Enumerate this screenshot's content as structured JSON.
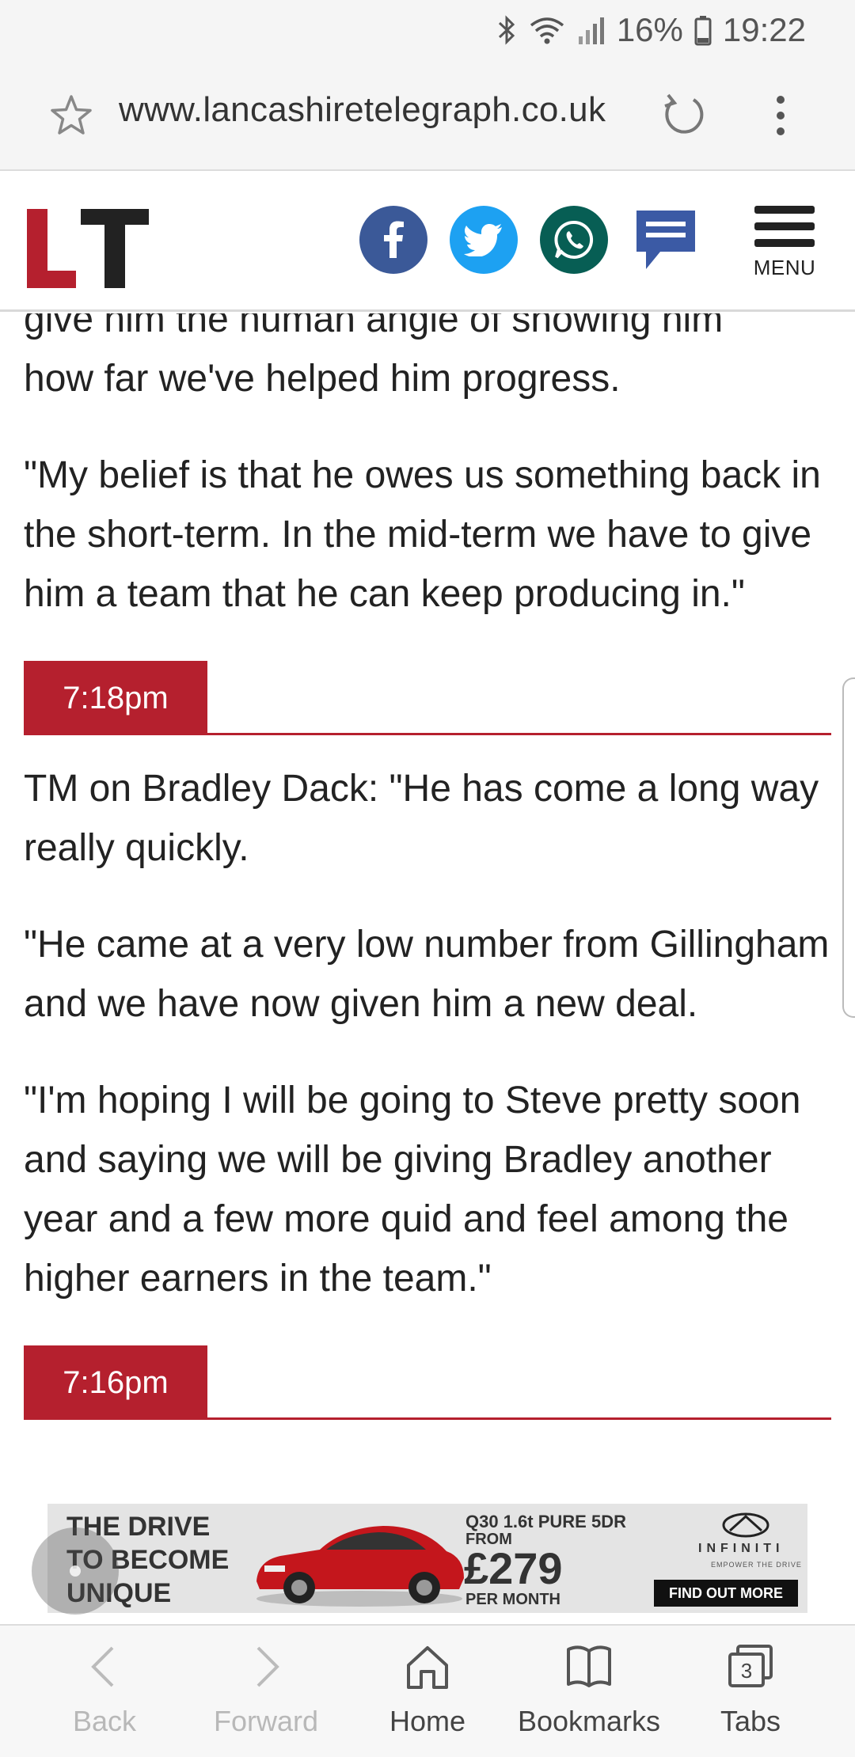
{
  "status_bar": {
    "battery": "16%",
    "time": "19:22",
    "icons": [
      "bluetooth-icon",
      "wifi-icon",
      "signal-icon",
      "battery-icon"
    ]
  },
  "browser": {
    "url": "www.lancashiretelegraph.co.uk"
  },
  "site": {
    "logo_text": "LT",
    "menu_label": "MENU",
    "brand_color": "#b5202e"
  },
  "article": {
    "partial_line": "give him the human angle of showing him",
    "paragraphs": [
      "how far we've helped him progress.",
      "\"My belief is that he owes us something back in the short-term. In the mid-term we have to give him a team that he can keep producing in.\""
    ],
    "updates": [
      {
        "time": "7:18pm",
        "paragraphs": [
          "TM on Bradley Dack: \"He has come a long way really quickly.",
          "\"He came at a very low number from Gillingham and we have now given him a new deal.",
          "\"I'm hoping I will be going to Steve pretty soon and saying we will be giving Bradley another year and a few more quid and feel among the higher earners in the team.\""
        ]
      },
      {
        "time": "7:16pm",
        "paragraphs": []
      }
    ]
  },
  "ad": {
    "headline_1": "THE DRIVE",
    "headline_2": "TO BECOME",
    "headline_3": "UNIQUE",
    "model": "Q30 1.6t PURE 5DR",
    "from": "FROM",
    "price": "£279",
    "per": "PER MONTH",
    "brand": "INFINITI",
    "tagline": "EMPOWER THE DRIVE",
    "cta": "FIND OUT MORE"
  },
  "bottom_nav": {
    "back": "Back",
    "forward": "Forward",
    "home": "Home",
    "bookmarks": "Bookmarks",
    "tabs": "Tabs",
    "tab_count": "3"
  }
}
